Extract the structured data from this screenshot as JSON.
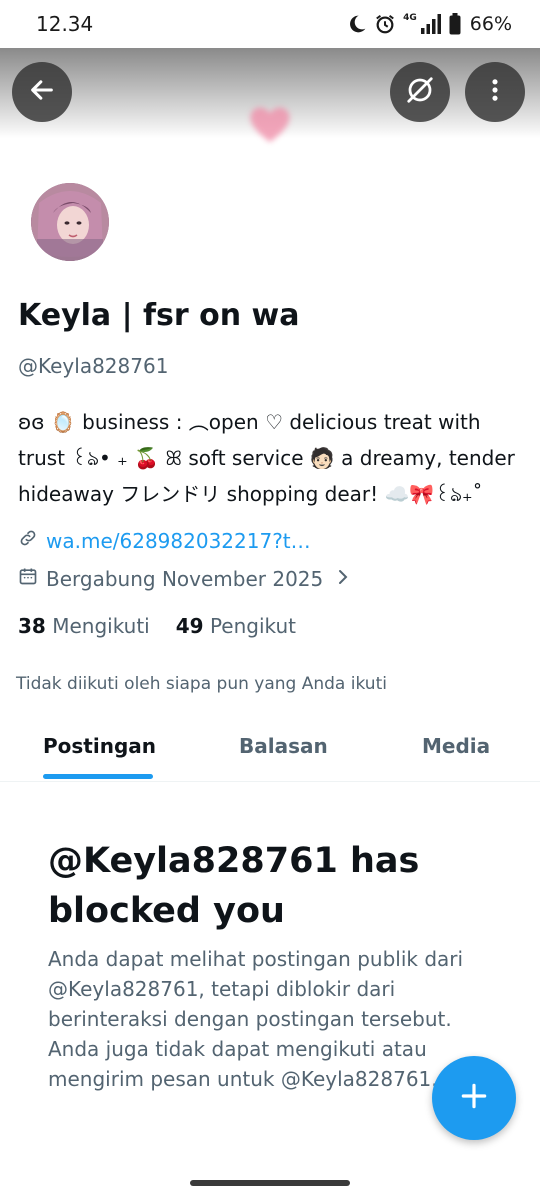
{
  "status_bar": {
    "time": "12.34",
    "network": "4G",
    "battery": "66%"
  },
  "profile": {
    "display_name": "Keyla | fsr on wa",
    "handle": "@Keyla828761",
    "bio": "ʚɞ 🪞 business : ︵open ♡ delicious treat with trust ꒰ঌ• ₊ 🍒 ꕤ soft service 🧑🏻 a dreamy, tender hideaway フレンドリ shopping dear! ☁️🎀꒰ঌ₊˚",
    "link": "wa.me/628982032217?t…",
    "joined": "Bergabung November 2025",
    "following_count": "38",
    "following_label": "Mengikuti",
    "followers_count": "49",
    "followers_label": "Pengikut",
    "followed_by_note": "Tidak diikuti oleh siapa pun yang Anda ikuti"
  },
  "tabs": [
    {
      "label": "Postingan",
      "active": true
    },
    {
      "label": "Balasan",
      "active": false
    },
    {
      "label": "Media",
      "active": false
    }
  ],
  "blocked": {
    "title": "@Keyla828761 has blocked you",
    "description": "Anda dapat melihat postingan publik dari @Keyla828761, tetapi diblokir dari berinteraksi dengan postingan tersebut. Anda juga tidak dapat mengikuti atau mengirim pesan untuk @Keyla828761."
  },
  "icons": {
    "back": "arrow-left-icon",
    "explore": "explore-off-icon",
    "more": "more-vertical-icon",
    "link": "link-icon",
    "calendar": "calendar-icon",
    "chevron": "chevron-right-icon",
    "compose": "plus-icon"
  },
  "colors": {
    "accent": "#1d9bf0",
    "text_primary": "#0f1419",
    "text_secondary": "#536471"
  }
}
